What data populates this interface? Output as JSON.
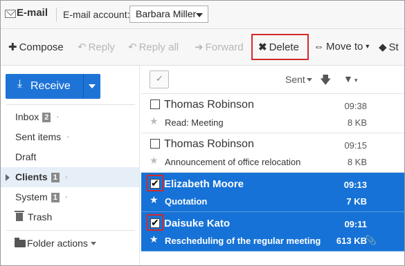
{
  "header": {
    "app_title": "E-mail",
    "account_label": "E-mail account:",
    "account_value": "Barbara Miller"
  },
  "toolbar": {
    "compose": "Compose",
    "reply": "Reply",
    "reply_all": "Reply all",
    "forward": "Forward",
    "delete": "Delete",
    "move_to": "Move to",
    "truncated": "St"
  },
  "sidebar": {
    "receive": "Receive",
    "folders": [
      {
        "label": "Inbox",
        "badge": "2"
      },
      {
        "label": "Sent items"
      },
      {
        "label": "Draft"
      },
      {
        "label": "Clients",
        "badge": "1"
      },
      {
        "label": "System",
        "badge": "1"
      },
      {
        "label": "Trash"
      }
    ],
    "folder_actions": "Folder actions"
  },
  "list": {
    "sort_label": "Sent",
    "messages": [
      {
        "sender": "Thomas Robinson",
        "time": "09:38",
        "subject": "Read: Meeting",
        "size": "8 KB",
        "selected": false
      },
      {
        "sender": "Thomas Robinson",
        "time": "09:15",
        "subject": "Announcement of office relocation",
        "size": "8 KB",
        "selected": false
      },
      {
        "sender": "Elizabeth Moore",
        "time": "09:13",
        "subject": "Quotation",
        "size": "7 KB",
        "selected": true
      },
      {
        "sender": "Daisuke Kato",
        "time": "09:11",
        "subject": "Rescheduling of the regular meeting",
        "size": "613 KB",
        "selected": true,
        "attachment": true
      }
    ]
  },
  "colors": {
    "accent": "#1e74d6",
    "selected_row": "#1672d6",
    "highlight_box": "#d52828"
  }
}
